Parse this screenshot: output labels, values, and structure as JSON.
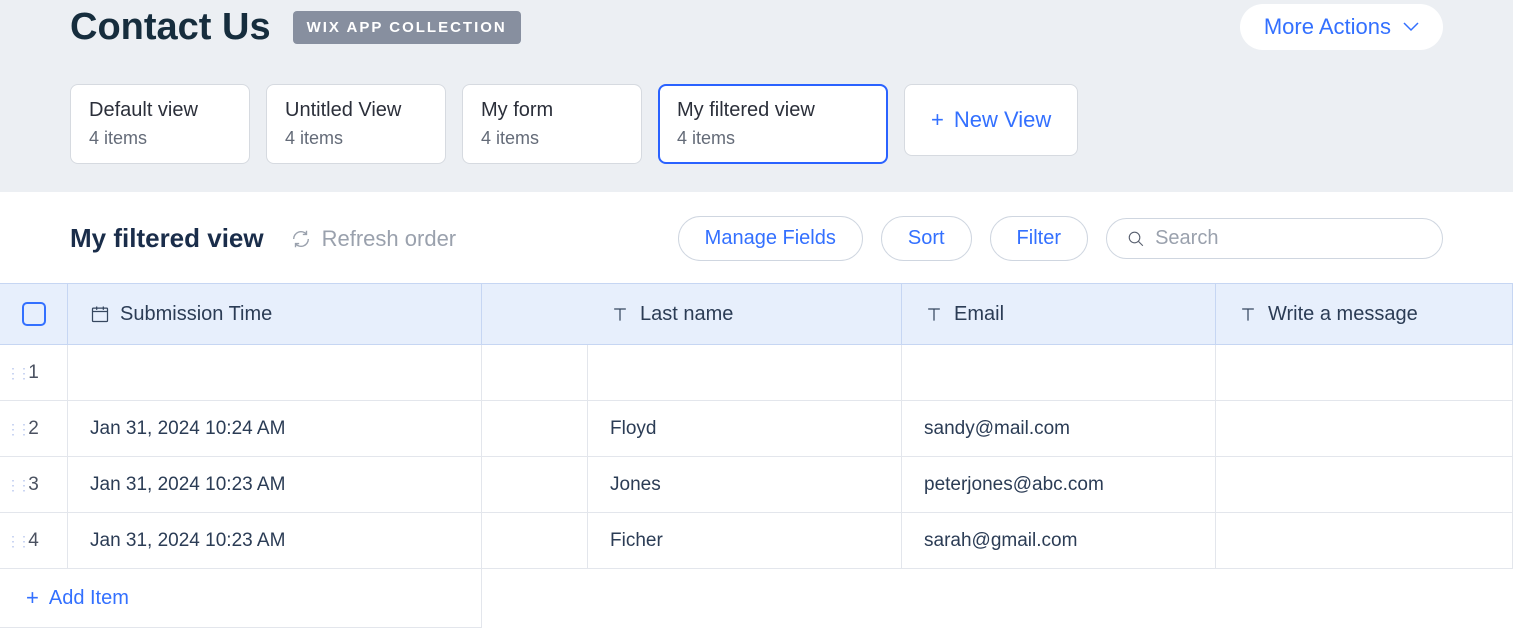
{
  "header": {
    "title": "Contact Us",
    "tag": "WIX APP COLLECTION",
    "more_actions": "More Actions"
  },
  "views": [
    {
      "label": "Default view",
      "count": "4 items"
    },
    {
      "label": "Untitled View",
      "count": "4 items"
    },
    {
      "label": "My form",
      "count": "4 items"
    },
    {
      "label": "My filtered view",
      "count": "4 items"
    }
  ],
  "new_view_label": "New View",
  "toolbar": {
    "current_view": "My filtered view",
    "refresh_label": "Refresh order",
    "manage_fields": "Manage Fields",
    "sort": "Sort",
    "filter": "Filter",
    "search_placeholder": "Search"
  },
  "columns": {
    "submission_time": "Submission Time",
    "last_name": "Last name",
    "email": "Email",
    "message": "Write a message"
  },
  "rows": [
    {
      "num": "1",
      "time": "",
      "last": "",
      "email": "",
      "msg": ""
    },
    {
      "num": "2",
      "time": "Jan 31, 2024 10:24 AM",
      "last": "Floyd",
      "email": "sandy@mail.com",
      "msg": ""
    },
    {
      "num": "3",
      "time": "Jan 31, 2024 10:23 AM",
      "last": "Jones",
      "email": "peterjones@abc.com",
      "msg": ""
    },
    {
      "num": "4",
      "time": "Jan 31, 2024 10:23 AM",
      "last": "Ficher",
      "email": "sarah@gmail.com",
      "msg": ""
    }
  ],
  "add_item_label": "Add Item"
}
